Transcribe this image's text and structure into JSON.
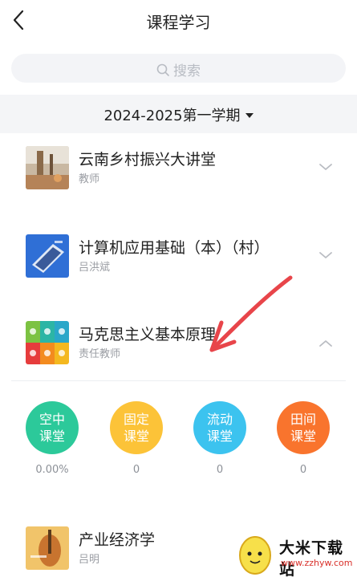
{
  "header": {
    "title": "课程学习"
  },
  "search": {
    "placeholder": "搜索"
  },
  "term": {
    "label": "2024-2025第一学期"
  },
  "courses": [
    {
      "name": "云南乡村振兴大讲堂",
      "teacher": "教师",
      "expanded": false
    },
    {
      "name": "计算机应用基础（本）（村）",
      "teacher": "吕洪斌",
      "expanded": false
    },
    {
      "name": "马克思主义基本原理",
      "teacher": "责任教师",
      "expanded": true
    },
    {
      "name": "产业经济学",
      "teacher": "吕明",
      "expanded": false
    }
  ],
  "classrooms": [
    {
      "line1": "空中",
      "line2": "课堂",
      "value": "0.00%",
      "color": "#2cc99a"
    },
    {
      "line1": "固定",
      "line2": "课堂",
      "value": "0",
      "color": "#fcc338"
    },
    {
      "line1": "流动",
      "line2": "课堂",
      "value": "0",
      "color": "#3cc3ef"
    },
    {
      "line1": "田间",
      "line2": "课堂",
      "value": "0",
      "color": "#f9742d"
    }
  ],
  "watermark": {
    "text": "大米下载站",
    "url": "www.zzhyw.com"
  },
  "icons": {
    "back": "back-arrow-icon",
    "search": "search-icon",
    "dropdown": "caret-down-icon",
    "expand": "chevron-down-icon",
    "collapse": "chevron-up-icon"
  }
}
